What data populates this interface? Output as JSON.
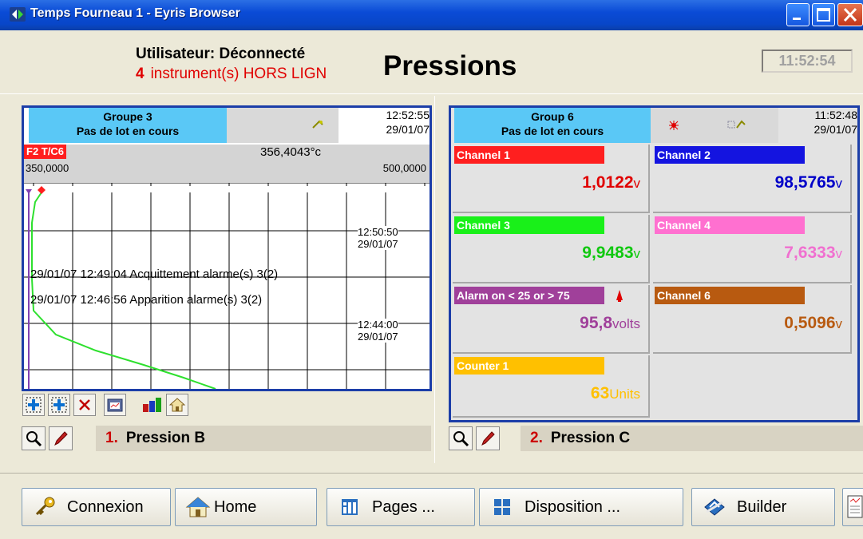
{
  "window": {
    "title": "Temps Fourneau 1 - Eyris Browser"
  },
  "header": {
    "user_status": "Utilisateur: Déconnecté",
    "offline_count": "4",
    "offline_text": "instrument(s) HORS LIGN",
    "page_title": "Pressions",
    "clock": "11:52:54"
  },
  "left": {
    "group_name": "Groupe 3",
    "batch_status": "Pas de lot en cours",
    "time": "12:52:55",
    "date": "29/01/07",
    "tag": "F2 T/C6",
    "reading": "356,4043°c",
    "scale_min": "350,0000",
    "scale_max": "500,0000",
    "ts1_time": "12:50:50",
    "ts1_date": "29/01/07",
    "ts2_time": "12:44:00",
    "ts2_date": "29/01/07",
    "events": [
      "29/01/07 12:49:04 Acquittement alarme(s) 3(2)",
      "29/01/07 12:46:56 Apparition alarme(s) 3(2)"
    ],
    "view_number": "1.",
    "view_name": "Pression B"
  },
  "right": {
    "group_name": "Group 6",
    "batch_status": "Pas de lot en cours",
    "time": "11:52:48",
    "date": "29/01/07",
    "channels": [
      {
        "label": "Channel 1",
        "value": "1,0122",
        "unit": "v",
        "color": "#ff1f1f",
        "value_color": "#e00000"
      },
      {
        "label": "Channel 2",
        "value": "98,5765",
        "unit": "v",
        "color": "#1414e0",
        "value_color": "#0000c8"
      },
      {
        "label": "Channel 3",
        "value": "9,9483",
        "unit": "v",
        "color": "#19f019",
        "value_color": "#10c810"
      },
      {
        "label": "Channel 4",
        "value": "7,6333",
        "unit": "v",
        "color": "#ff70d0",
        "value_color": "#f070d0"
      },
      {
        "label": "Alarm on < 25 or > 75",
        "value": "95,8",
        "unit": "volts",
        "color": "#a0409a",
        "value_color": "#a0409a"
      },
      {
        "label": "Channel 6",
        "value": "0,5096",
        "unit": "v",
        "color": "#b85a10",
        "value_color": "#b85a10"
      },
      {
        "label": "Counter 1",
        "value": "63",
        "unit": "Units",
        "color": "#ffc000",
        "value_color": "#ffc000"
      }
    ],
    "view_number": "2.",
    "view_name": "Pression C"
  },
  "bottom": {
    "connexion": "Connexion",
    "home": "Home",
    "pages": "Pages ...",
    "disposition": "Disposition ...",
    "builder": "Builder"
  }
}
